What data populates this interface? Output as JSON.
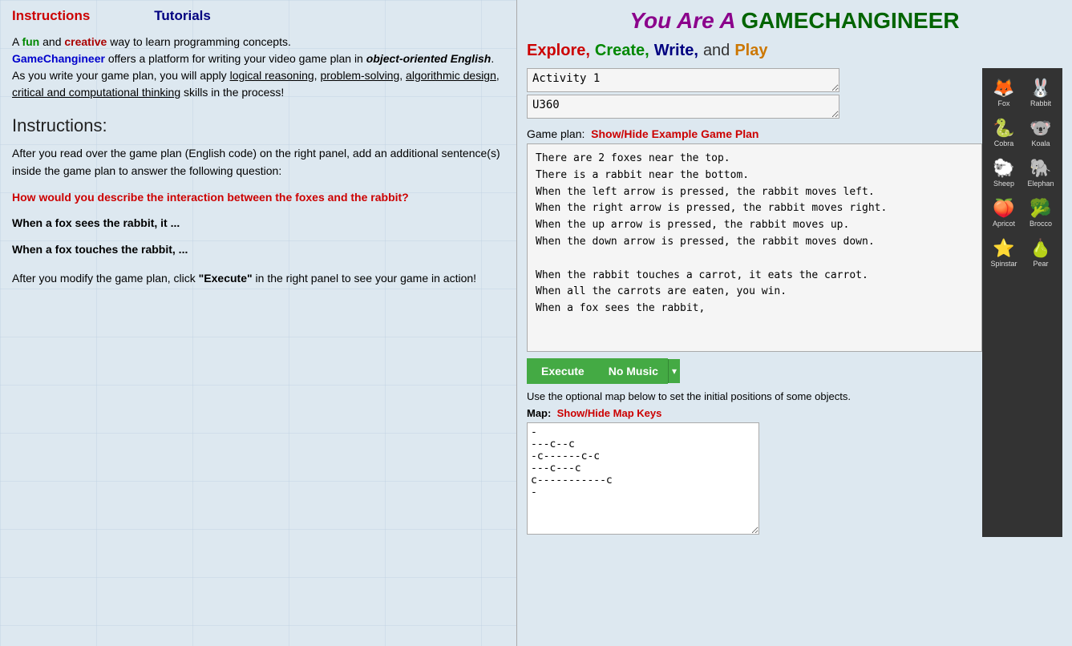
{
  "left": {
    "nav": {
      "instructions": "Instructions",
      "tutorials": "Tutorials"
    },
    "intro": {
      "text1": "A ",
      "fun": "fun",
      "text2": " and ",
      "creative": "creative",
      "text3": " way to learn programming concepts.",
      "gamechangineer": "GameChangineer",
      "text4": " offers a platform for writing your video game plan in ",
      "bold_italic": "object-oriented English",
      "text5": ". As you write your game plan, you will apply ",
      "link1": "logical reasoning",
      "comma1": ", ",
      "link2": "problem-solving",
      "comma2": ", ",
      "link3": "algorithmic design",
      "comma3": ", ",
      "link4": "critical and computational thinking",
      "text6": " skills in the process!"
    },
    "instructions_heading": "Instructions:",
    "body1": "After you read over the game plan (English code) on the right panel, add an additional sentence(s) inside the game plan to answer the following question:",
    "question": "How would you describe the interaction between the foxes and the rabbit?",
    "hint1": "When a fox sees the rabbit, it ...",
    "hint2": "When a fox touches the rabbit, ...",
    "body2": "After you modify the game plan, click ",
    "execute_link": "\"Execute\"",
    "body3": " in the right panel to see your game in action!"
  },
  "right": {
    "header": {
      "you_are_a": "You Are A ",
      "gamechangineer": "GAMECHANGINEER"
    },
    "explore": "Explore,",
    "create": "Create,",
    "write": "Write,",
    "and": "and",
    "play": "Play",
    "activity_label": "Activity 1",
    "u360_label": "U360",
    "game_plan_label": "Game plan:",
    "show_hide_example": "Show/Hide Example Game Plan",
    "code": "There are 2 foxes near the top.\nThere is a rabbit near the bottom.\nWhen the left arrow is pressed, the rabbit moves left.\nWhen the right arrow is pressed, the rabbit moves right.\nWhen the up arrow is pressed, the rabbit moves up.\nWhen the down arrow is pressed, the rabbit moves down.\n\nWhen the rabbit touches a carrot, it eats the carrot.\nWhen all the carrots are eaten, you win.\nWhen a fox sees the rabbit,",
    "execute_btn": "Execute",
    "no_music_btn": "No Music",
    "dropdown_arrow": "▾",
    "map_info": "Use the optional map below to set the initial positions of some objects.",
    "map_label": "Map:",
    "show_hide_map": "Show/Hide Map Keys",
    "map_content": "-\n---c--c\n-c------c-c\n---c---c\nc-----------c\n-",
    "icons": [
      {
        "emoji": "🦊",
        "label": "Fox"
      },
      {
        "emoji": "🐰",
        "label": "Rabbit"
      },
      {
        "emoji": "🐍",
        "label": "Cobra"
      },
      {
        "emoji": "🐨",
        "label": "Koala"
      },
      {
        "emoji": "🐑",
        "label": "Sheep"
      },
      {
        "emoji": "🐘",
        "label": "Elephant"
      },
      {
        "emoji": "🍑",
        "label": "Apricot"
      },
      {
        "emoji": "🥦",
        "label": "Brocco"
      },
      {
        "emoji": "⭐",
        "label": "Spinstar"
      },
      {
        "emoji": "🍐",
        "label": "Pear"
      }
    ]
  }
}
